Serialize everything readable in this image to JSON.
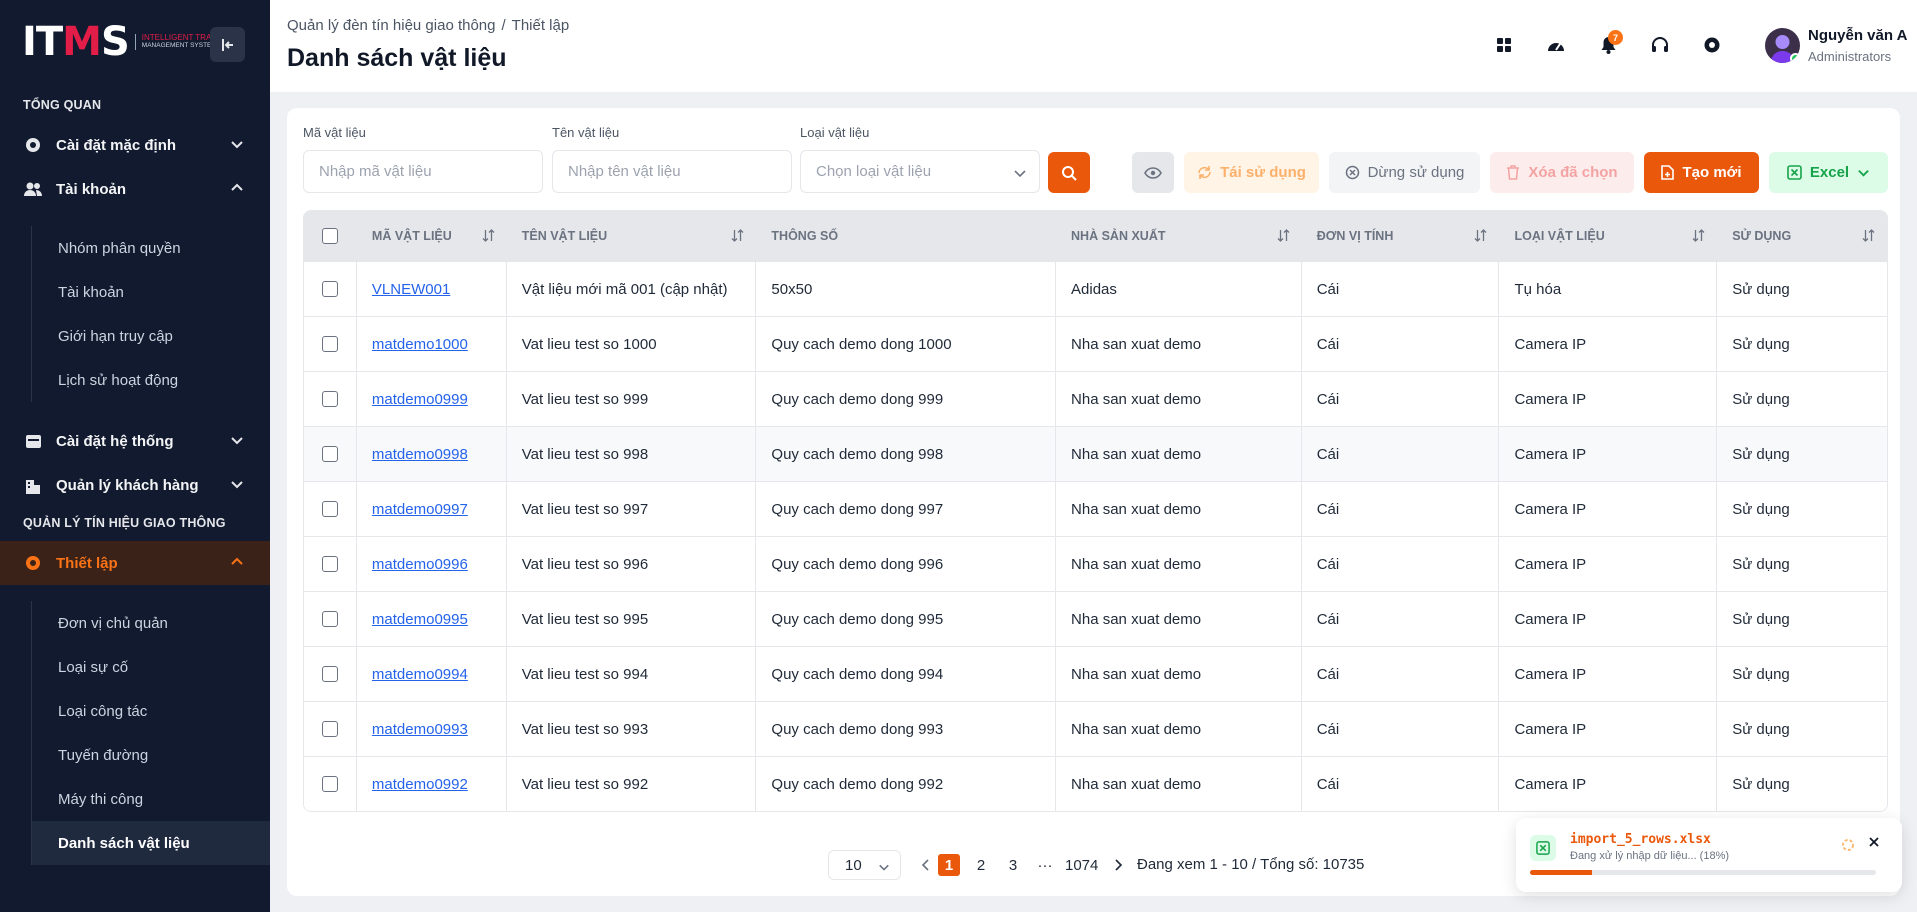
{
  "brand": {
    "logo_main": "ITMS",
    "logo_line1": "INTELLIGENT TRAFFIC",
    "logo_line2": "MANAGEMENT SYSTEM"
  },
  "sidebar": {
    "section_overview": "TỔNG QUAN",
    "default_settings": "Cài đặt mặc định",
    "accounts": "Tài khoản",
    "account_items": [
      "Nhóm phân quyền",
      "Tài khoản",
      "Giới hạn truy cập",
      "Lịch sử hoạt động"
    ],
    "system_settings": "Cài đặt hệ thống",
    "customers": "Quản lý khách hàng",
    "section_signals": "QUẢN LÝ TÍN HIỆU GIAO THÔNG",
    "setup": "Thiết lập",
    "setup_items": [
      "Đơn vị chủ quản",
      "Loại sự cố",
      "Loại công tác",
      "Tuyến đường",
      "Máy thi công",
      "Danh sách vật liệu"
    ]
  },
  "header": {
    "breadcrumb": [
      "Quản lý đèn tín hiệu giao thông",
      "Thiết lập"
    ],
    "title": "Danh sách vật liệu",
    "notification_count": "7",
    "user_name": "Nguyễn văn A",
    "user_role": "Administrators"
  },
  "filters": {
    "code_label": "Mã vật liệu",
    "code_placeholder": "Nhập mã vật liệu",
    "name_label": "Tên vật liệu",
    "name_placeholder": "Nhập tên vật liệu",
    "type_label": "Loại vật liệu",
    "type_placeholder": "Chọn loại vật liệu"
  },
  "actions": {
    "reuse": "Tái sử dụng",
    "stop": "Dừng sử dụng",
    "delete": "Xóa đã chọn",
    "create": "Tạo mới",
    "excel": "Excel"
  },
  "table": {
    "columns": [
      "MÃ VẬT LIỆU",
      "TÊN VẬT LIỆU",
      "THÔNG SỐ",
      "NHÀ SẢN XUẤT",
      "ĐƠN VỊ TÍNH",
      "LOẠI VẬT LIỆU",
      "SỬ DỤNG"
    ],
    "rows": [
      [
        "VLNEW001",
        "Vật liệu mới mã 001 (cập nhật)",
        "50x50",
        "Adidas",
        "Cái",
        "Tụ hóa",
        "Sử dụng"
      ],
      [
        "matdemo1000",
        "Vat lieu test so 1000",
        "Quy cach demo dong 1000",
        "Nha san xuat demo",
        "Cái",
        "Camera IP",
        "Sử dụng"
      ],
      [
        "matdemo0999",
        "Vat lieu test so 999",
        "Quy cach demo dong 999",
        "Nha san xuat demo",
        "Cái",
        "Camera IP",
        "Sử dụng"
      ],
      [
        "matdemo0998",
        "Vat lieu test so 998",
        "Quy cach demo dong 998",
        "Nha san xuat demo",
        "Cái",
        "Camera IP",
        "Sử dụng"
      ],
      [
        "matdemo0997",
        "Vat lieu test so 997",
        "Quy cach demo dong 997",
        "Nha san xuat demo",
        "Cái",
        "Camera IP",
        "Sử dụng"
      ],
      [
        "matdemo0996",
        "Vat lieu test so 996",
        "Quy cach demo dong 996",
        "Nha san xuat demo",
        "Cái",
        "Camera IP",
        "Sử dụng"
      ],
      [
        "matdemo0995",
        "Vat lieu test so 995",
        "Quy cach demo dong 995",
        "Nha san xuat demo",
        "Cái",
        "Camera IP",
        "Sử dụng"
      ],
      [
        "matdemo0994",
        "Vat lieu test so 994",
        "Quy cach demo dong 994",
        "Nha san xuat demo",
        "Cái",
        "Camera IP",
        "Sử dụng"
      ],
      [
        "matdemo0993",
        "Vat lieu test so 993",
        "Quy cach demo dong 993",
        "Nha san xuat demo",
        "Cái",
        "Camera IP",
        "Sử dụng"
      ],
      [
        "matdemo0992",
        "Vat lieu test so 992",
        "Quy cach demo dong 992",
        "Nha san xuat demo",
        "Cái",
        "Camera IP",
        "Sử dụng"
      ]
    ]
  },
  "pagination": {
    "page_size": "10",
    "pages": [
      "1",
      "2",
      "3"
    ],
    "ellipsis": "···",
    "last_page": "1074",
    "info": "Đang xem 1 - 10 / Tổng số: 10735"
  },
  "toast": {
    "file": "import_5_rows.xlsx",
    "message": "Đang xử lý nhập dữ liệu... (18%)",
    "progress": 0.18
  },
  "colors": {
    "accent": "#ea580c",
    "sidebar_bg": "#111a2e",
    "link": "#2563eb",
    "success": "#16a34a"
  },
  "icons": [
    "collapse-icon",
    "gear-icon",
    "users-icon",
    "calendar-icon",
    "building-icon",
    "apps-icon",
    "dashboard-icon",
    "bell-icon",
    "headset-icon",
    "search-icon",
    "eye-icon",
    "recycle-icon",
    "stop-icon",
    "trash-icon",
    "file-plus-icon",
    "excel-icon",
    "sort-icon",
    "chevron-down-icon",
    "chevron-up-icon",
    "chevron-left-icon",
    "chevron-right-icon",
    "close-icon",
    "spinner-icon"
  ]
}
